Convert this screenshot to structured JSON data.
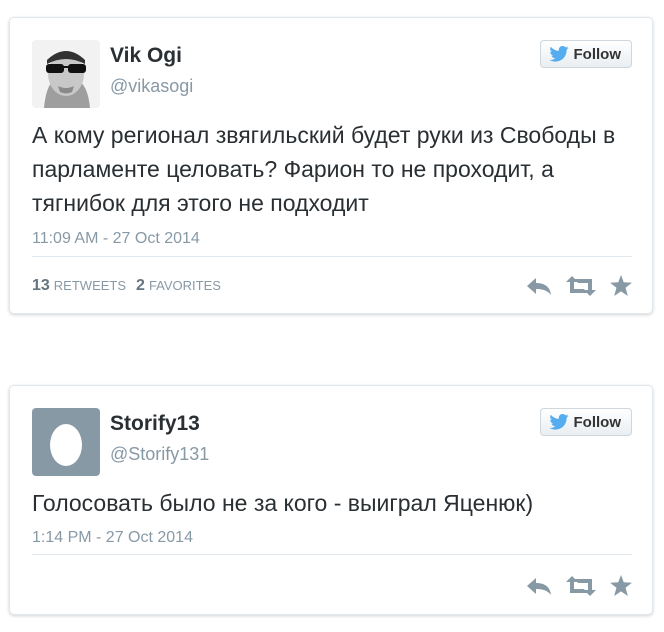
{
  "tweets": [
    {
      "name": "Vik Ogi",
      "handle": "@vikasogi",
      "follow_label": "Follow",
      "text": "А кому регионал звягильский будет руки из Свободы в парламенте целовать? Фарион то не проходит, а тягнибок для этого не подходит",
      "timestamp": "11:09 AM - 27 Oct 2014",
      "retweets_count": "13",
      "retweets_label": "RETWEETS",
      "favorites_count": "2",
      "favorites_label": "FAVORITES",
      "avatar": "sunglasses-man-photo"
    },
    {
      "name": "Storify13",
      "handle": "@Storify131",
      "follow_label": "Follow",
      "text": "Голосовать было не за кого - выиграл Яценюк)",
      "timestamp": "1:14 PM - 27 Oct 2014",
      "avatar": "default-egg"
    }
  ],
  "colors": {
    "twitter_blue": "#55acee",
    "text": "#292f33",
    "muted": "#8899a6",
    "icon": "#8899a6",
    "egg_bg": "#8899a6"
  },
  "icons": [
    "twitter-bird-icon",
    "reply-icon",
    "retweet-icon",
    "favorite-star-icon"
  ]
}
